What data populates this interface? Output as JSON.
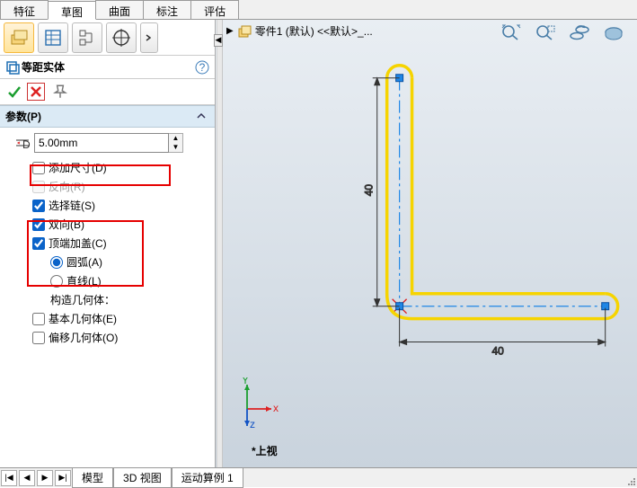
{
  "top_tabs": {
    "features": "特征",
    "sketch": "草图",
    "surfaces": "曲面",
    "annotate": "标注",
    "evaluate": "评估"
  },
  "pm": {
    "title": "等距实体",
    "params_header": "参数(P)",
    "distance": "5.00mm",
    "opts": {
      "add_dim": "添加尺寸(D)",
      "reverse": "反向(R)",
      "select_chain": "选择链(S)",
      "bi_dir": "双向(B)",
      "cap_ends": "顶端加盖(C)",
      "arcs": "圆弧(A)",
      "lines": "直线(L)",
      "construct_label": "构造几何体：",
      "base_geom": "基本几何体(E)",
      "offset_geom": "偏移几何体(O)"
    }
  },
  "tree": {
    "part_label": "零件1 (默认) <<默认>_..."
  },
  "bottom_tabs": {
    "model": "模型",
    "view3d": "3D 视图",
    "motion": "运动算例 1"
  },
  "orient": "*上视",
  "axes": {
    "x": "x",
    "y": "Y",
    "z": "z"
  },
  "chart_data": {
    "type": "sketch",
    "dim_vertical": 40,
    "dim_horizontal": 40,
    "offset_distance": 5.0,
    "units": "mm"
  }
}
